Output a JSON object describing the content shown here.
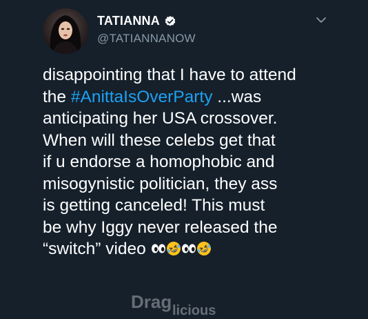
{
  "tweet": {
    "display_name": "TATIANNA",
    "handle": "@TATIANNANOW",
    "lines": [
      {
        "text": "disappointing that I have to attend"
      },
      {
        "prefix": "the ",
        "hashtag": "#AnittaIsOverParty",
        "suffix": " ...was"
      },
      {
        "text": "anticipating her USA crossover."
      },
      {
        "text": "When will these celebs get that"
      },
      {
        "text": "if u endorse a homophobic and"
      },
      {
        "text": "misogynistic politician, they ass"
      },
      {
        "text": "is getting canceled! This must"
      },
      {
        "text": "be why Iggy never released the"
      },
      {
        "text": "“switch” video "
      }
    ],
    "emojis": [
      "eyes-emoji",
      "rofl-emoji",
      "eyes-emoji",
      "rofl-emoji"
    ]
  },
  "watermark": {
    "part1": "Drag",
    "part2": "licious"
  },
  "colors": {
    "background": "#15202b",
    "hashtag": "#1da1f2",
    "handle": "#8899a6",
    "verified": "#ffffff"
  }
}
